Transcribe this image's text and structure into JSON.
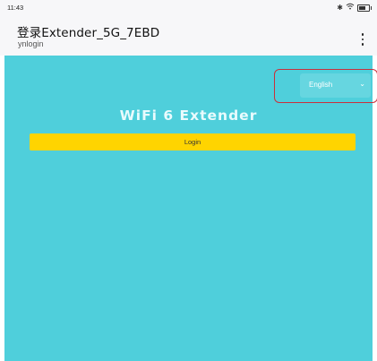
{
  "status_bar": {
    "time": "11:43",
    "icons": [
      "bluetooth-icon",
      "wifi-icon",
      "battery-icon"
    ]
  },
  "header": {
    "title": "登录Extender_5G_7EBD",
    "subtitle": "ynlogin",
    "menu_icon": "more-vertical-icon"
  },
  "page": {
    "background_color": "#4fcfdb",
    "language_select": {
      "selected": "English",
      "highlight_color": "#c9303b"
    },
    "brand_title": "WiFi 6 Extender",
    "login_button": {
      "label": "Login",
      "color": "#ffd400"
    }
  }
}
